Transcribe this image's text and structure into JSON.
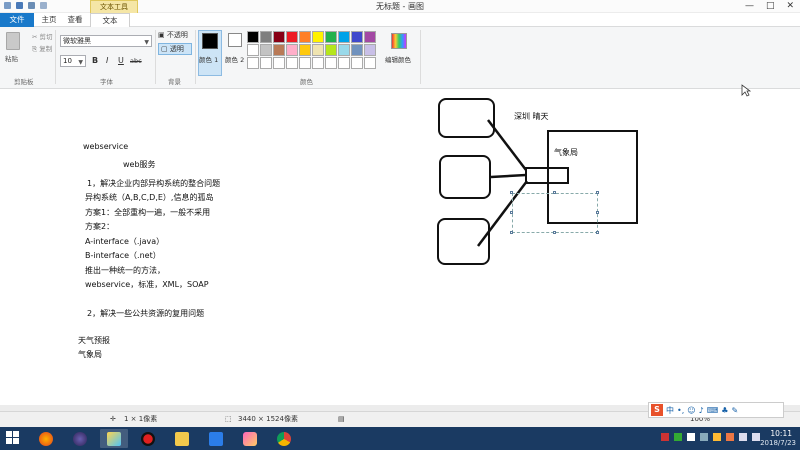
{
  "window": {
    "title": "无标题 - 画图",
    "context_tab": "文本工具",
    "controls": [
      "—",
      "□",
      "✕"
    ]
  },
  "tabs": {
    "file": "文件",
    "home": "主页",
    "view": "查看",
    "text": "文本"
  },
  "ribbon": {
    "clipboard": {
      "paste": "粘贴",
      "cut": "剪切",
      "copy": "复制",
      "label": "剪贴板"
    },
    "font": {
      "family": "微软雅黑",
      "size": "10",
      "bold": "B",
      "italic": "I",
      "underline": "U",
      "strike": "abc",
      "label": "字体"
    },
    "background": {
      "opaque": "不透明",
      "transparent": "透明",
      "label": "背景"
    },
    "colors": {
      "color1": "颜色 1",
      "color2": "颜色 2",
      "edit": "编辑颜色",
      "label": "颜色",
      "color1_value": "#000000",
      "color2_value": "#ffffff",
      "palette": [
        "#000000",
        "#7f7f7f",
        "#880015",
        "#ed1c24",
        "#ff7f27",
        "#fff200",
        "#22b14c",
        "#00a2e8",
        "#3f48cc",
        "#a349a4",
        "#ffffff",
        "#c3c3c3",
        "#b97a57",
        "#ffaec9",
        "#ffc90e",
        "#efe4b0",
        "#b5e61d",
        "#99d9ea",
        "#7092be",
        "#c8bfe7",
        "#ffffff",
        "#ffffff",
        "#ffffff",
        "#ffffff",
        "#ffffff",
        "#ffffff",
        "#ffffff",
        "#ffffff",
        "#ffffff",
        "#ffffff"
      ]
    }
  },
  "canvas": {
    "notes": [
      "webservice",
      "web服务",
      "1，解决企业内部异构系统的整合问题",
      "异构系统（A,B,C,D,E）,信息的孤岛",
      "方案1：全部重构一遍，一般不采用",
      "方案2：",
      "A-interface（.java）",
      "B-interface（.net）",
      "推出一种统一的方法，",
      "webservice，标准，XML，SOAP",
      "2，解决一些公共资源的复用问题",
      "天气预报",
      "气象局"
    ],
    "diagram": {
      "textbox": "深圳 晴天",
      "box_label": "气象局"
    }
  },
  "status": {
    "cursor": "1 × 1像素",
    "image_size": "3440 × 1524像素",
    "zoom": "100%"
  },
  "ime": {
    "logo": "S",
    "mode": "中"
  },
  "clock": {
    "time": "10:11",
    "date": "2018/7/23"
  }
}
